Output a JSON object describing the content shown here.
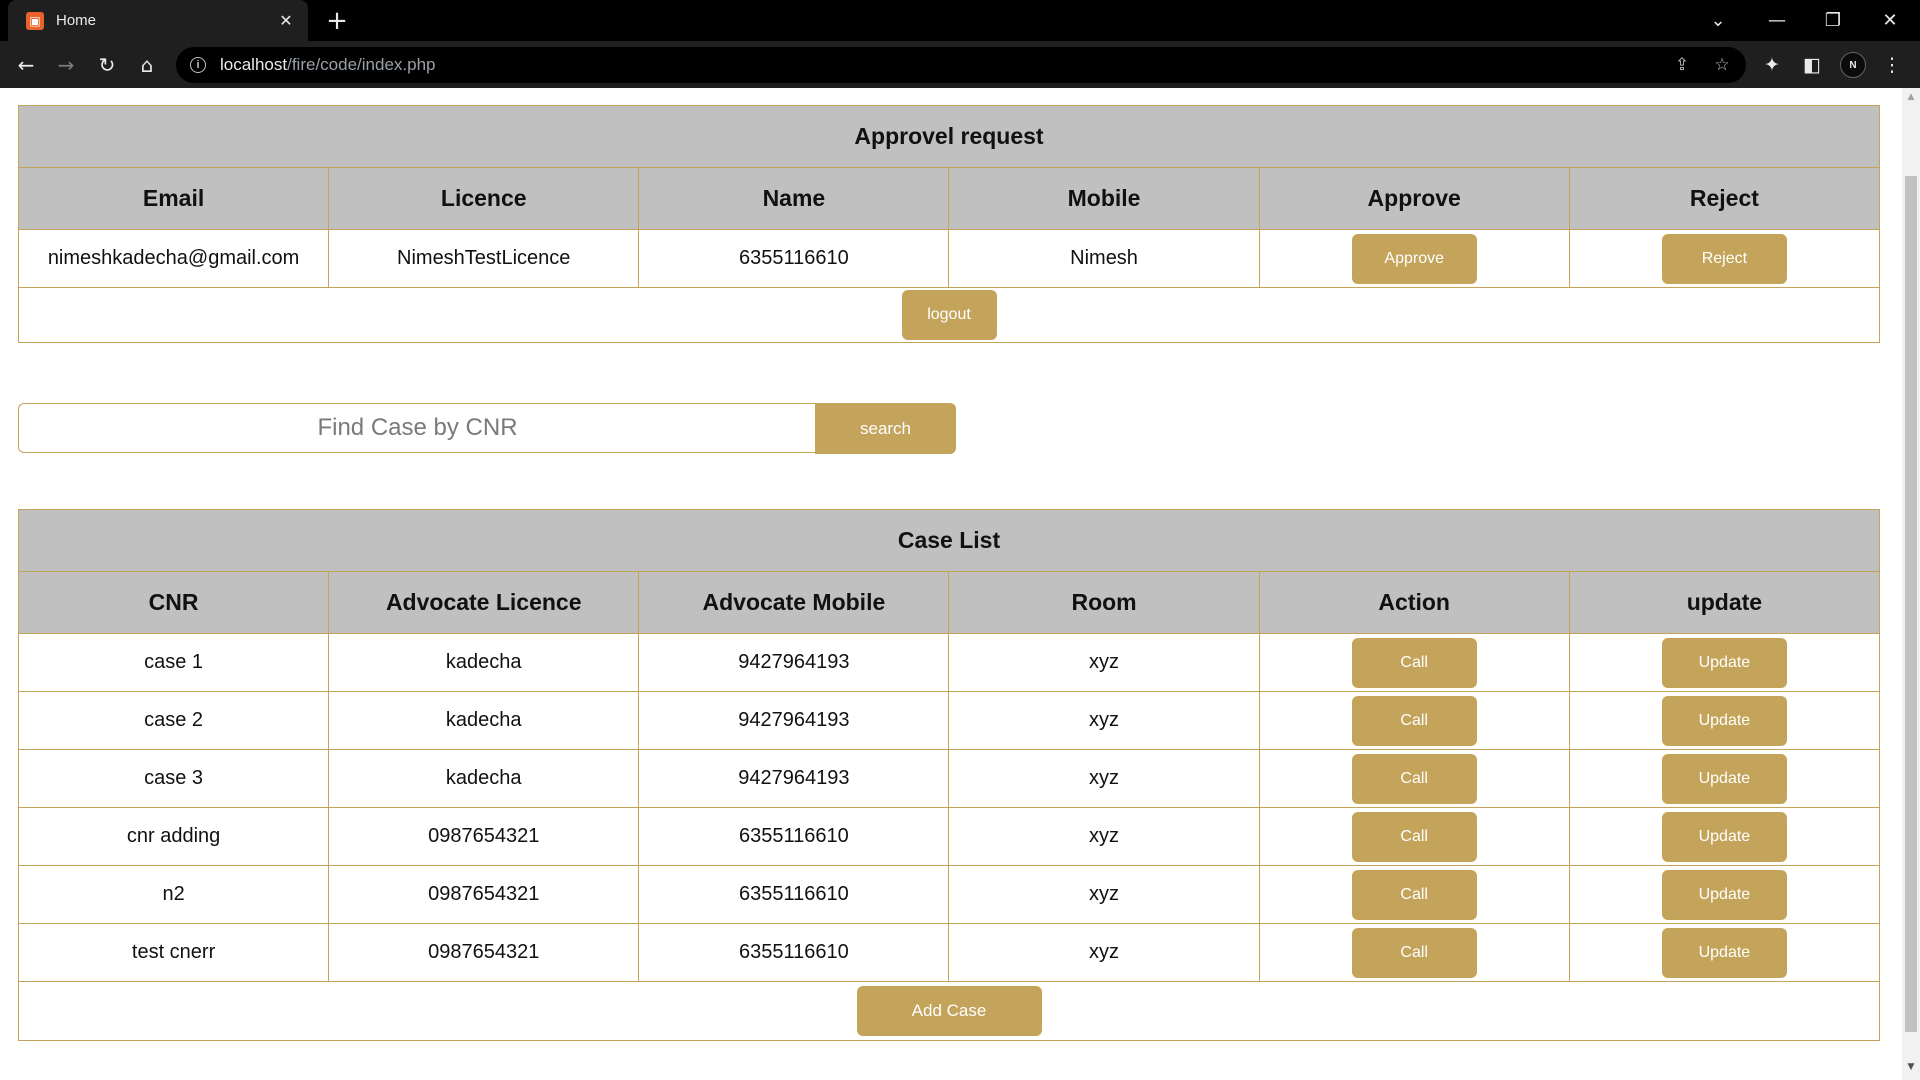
{
  "browser": {
    "tab_title": "Home",
    "url_host": "localhost",
    "url_path": "/fire/code/index.php",
    "avatar_initial": "N"
  },
  "approval": {
    "title": "Approvel request",
    "columns": [
      "Email",
      "Licence",
      "Name",
      "Mobile",
      "Approve",
      "Reject"
    ],
    "row": {
      "email": "nimeshkadecha@gmail.com",
      "licence": "NimeshTestLicence",
      "name": "6355116610",
      "mobile": "Nimesh",
      "approve_label": "Approve",
      "reject_label": "Reject"
    },
    "logout_label": "logout"
  },
  "search": {
    "placeholder": "Find Case by CNR",
    "button_label": "search"
  },
  "cases": {
    "title": "Case List",
    "columns": [
      "CNR",
      "Advocate Licence",
      "Advocate Mobile",
      "Room",
      "Action",
      "update"
    ],
    "rows": [
      {
        "cnr": "case 1",
        "licence": "kadecha",
        "mobile": "9427964193",
        "room": "xyz",
        "action": "Call",
        "update": "Update"
      },
      {
        "cnr": "case 2",
        "licence": "kadecha",
        "mobile": "9427964193",
        "room": "xyz",
        "action": "Call",
        "update": "Update"
      },
      {
        "cnr": "case 3",
        "licence": "kadecha",
        "mobile": "9427964193",
        "room": "xyz",
        "action": "Call",
        "update": "Update"
      },
      {
        "cnr": "cnr adding",
        "licence": "0987654321",
        "mobile": "6355116610",
        "room": "xyz",
        "action": "Call",
        "update": "Update"
      },
      {
        "cnr": "n2",
        "licence": "0987654321",
        "mobile": "6355116610",
        "room": "xyz",
        "action": "Call",
        "update": "Update"
      },
      {
        "cnr": "test cnerr",
        "licence": "0987654321",
        "mobile": "6355116610",
        "room": "xyz",
        "action": "Call",
        "update": "Update"
      }
    ],
    "add_label": "Add Case"
  },
  "theme": {
    "accent": "#c4a35a",
    "header_bg": "#c0c0c0"
  }
}
